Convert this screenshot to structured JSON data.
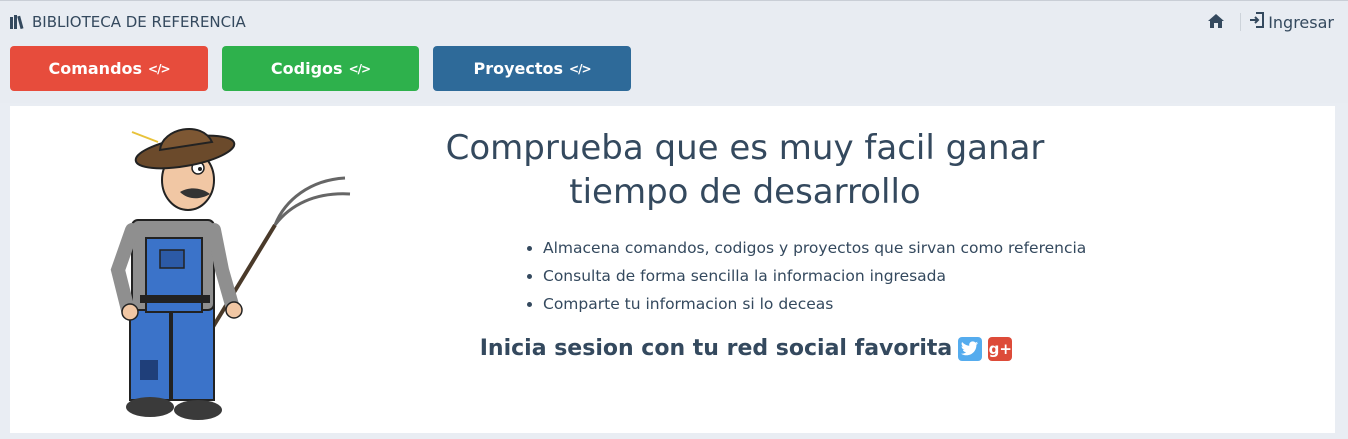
{
  "brand": {
    "title": "BIBLIOTECA DE REFERENCIA",
    "icon": "library-icon"
  },
  "nav": {
    "home_icon": "home-icon",
    "login_icon": "sign-in-icon",
    "login_label": "Ingresar"
  },
  "buttons": [
    {
      "label": "Comandos",
      "icon": "</>",
      "color": "#e74c3c"
    },
    {
      "label": "Codigos",
      "icon": "</>",
      "color": "#2eb14c"
    },
    {
      "label": "Proyectos",
      "icon": "</>",
      "color": "#2e6a99"
    }
  ],
  "hero": {
    "headline": "Comprueba que es muy facil ganar tiempo de desarrollo",
    "features": [
      "Almacena comandos, codigos y proyectos que sirvan como referencia",
      "Consulta de forma sencilla la informacion ingresada",
      "Comparte tu informacion si lo deceas"
    ],
    "cta": "Inicia sesion con tu red social favorita",
    "social_icons": [
      "twitter-icon",
      "google-plus-icon"
    ],
    "google_plus_glyph": "g+"
  },
  "colors": {
    "text": "#34495e",
    "background": "#e9edf3",
    "panel": "#ffffff"
  }
}
